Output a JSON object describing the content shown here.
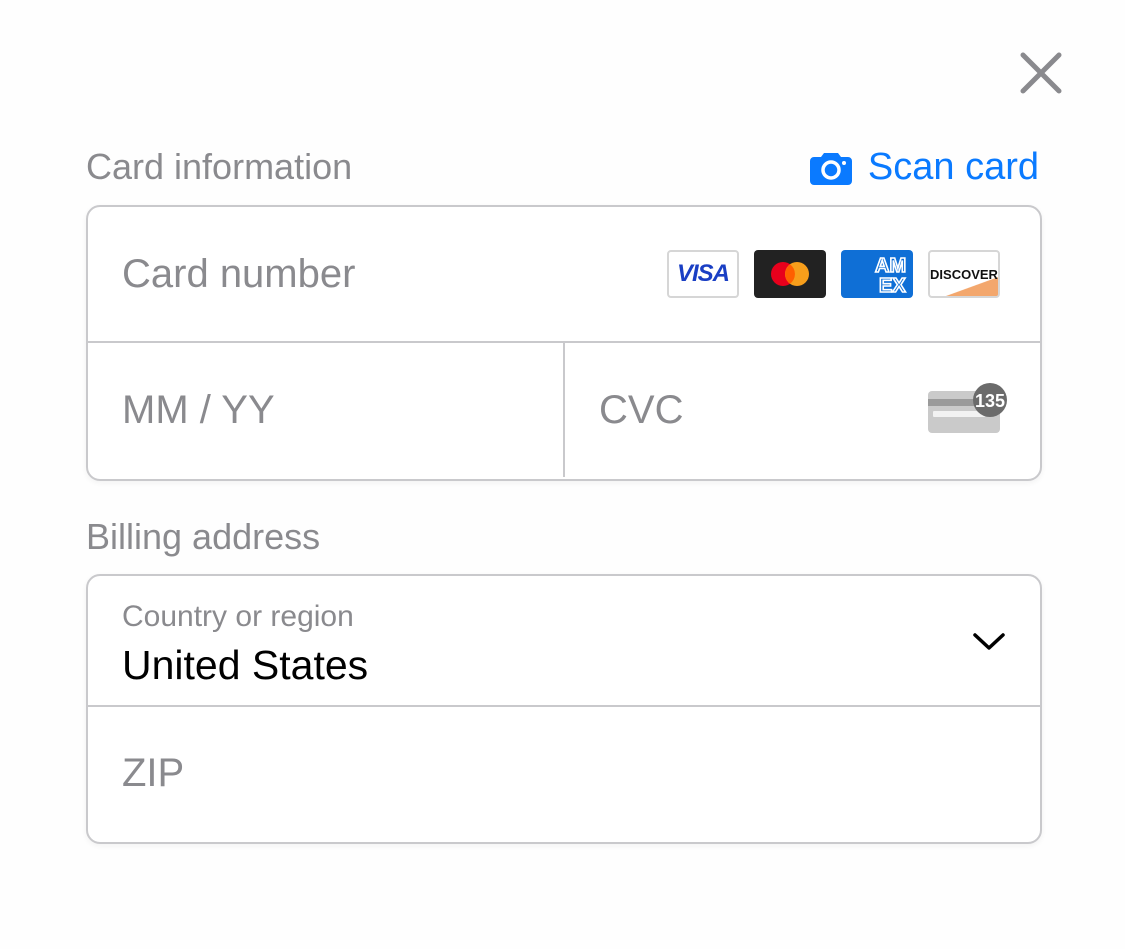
{
  "card_section": {
    "title": "Card information",
    "scan_label": "Scan card",
    "card_number_placeholder": "Card number",
    "expiry_placeholder": "MM / YY",
    "cvc_placeholder": "CVC",
    "cvc_icon_digits": "135",
    "brands": [
      "VISA",
      "Mastercard",
      "AMEX",
      "DISCOVER"
    ]
  },
  "billing_section": {
    "title": "Billing address",
    "country_label": "Country or region",
    "country_value": "United States",
    "zip_placeholder": "ZIP"
  },
  "colors": {
    "accent": "#0a7aff",
    "border": "#c9c9cc",
    "muted": "#8a8a8e"
  }
}
